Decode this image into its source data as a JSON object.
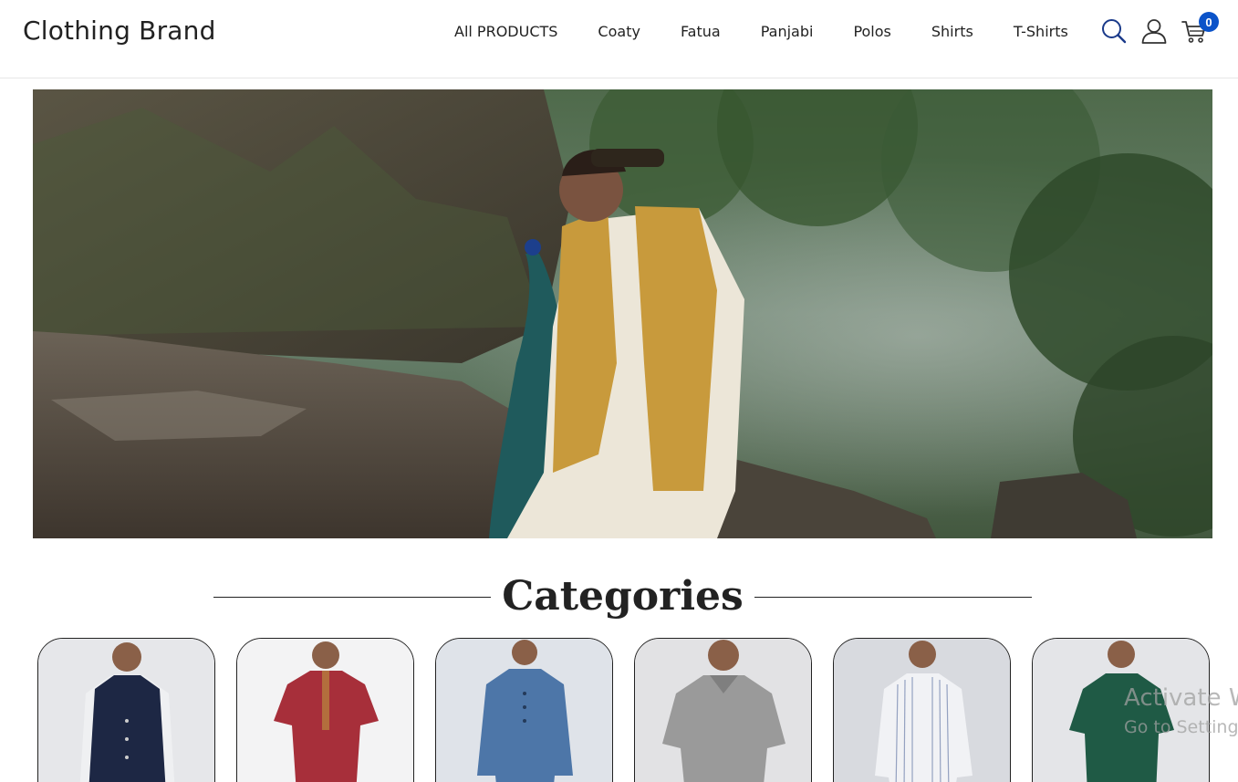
{
  "header": {
    "brand": "Clothing Brand",
    "nav": [
      {
        "label": "All PRODUCTS"
      },
      {
        "label": "Coaty"
      },
      {
        "label": "Fatua"
      },
      {
        "label": "Panjabi"
      },
      {
        "label": "Polos"
      },
      {
        "label": "Shirts"
      },
      {
        "label": "T-Shirts"
      }
    ],
    "icons": {
      "search": "search-icon",
      "account": "user-icon",
      "cart": "cart-icon"
    },
    "cart_count": "0",
    "accent_color": "#0b53c9"
  },
  "hero": {
    "image": "model in mustard floral vest and cream kurta beside a peacock on rocks in a forest"
  },
  "categories": {
    "title": "Categories",
    "items": [
      {
        "image": "navy coaty vest over white shirt",
        "color": "#1d2744"
      },
      {
        "image": "red short-sleeve fatua",
        "color": "#a72f3a"
      },
      {
        "image": "blue panjabi",
        "color": "#4d76a8"
      },
      {
        "image": "grey polo shirt",
        "color": "#9a9a9a"
      },
      {
        "image": "white striped shirt",
        "color": "#f1f2f5"
      },
      {
        "image": "green t-shirt",
        "color": "#1f5a45"
      }
    ]
  },
  "watermark": {
    "line1": "Activate W",
    "line2": "Go to Setting"
  }
}
